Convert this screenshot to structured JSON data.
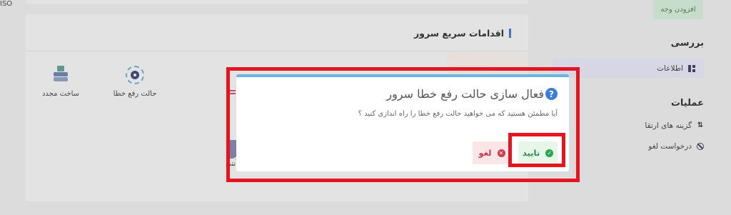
{
  "sidebar": {
    "add_funds_label": "افزودن وجه",
    "review_heading": "بررسی",
    "info_label": "اطلاعات",
    "operations_heading": "عملیات",
    "upgrade_label": "گزینه های ارتقا",
    "cancel_request_label": "درخواست لغو"
  },
  "quick_actions": {
    "title": "اقدامات سریع سرور",
    "actions": [
      {
        "label": "ساخت مجدد",
        "icon": "server-rebuild-icon"
      },
      {
        "label": "حالت رفع خطا",
        "icon": "rescue-gear-icon"
      },
      {
        "label": "ISO",
        "icon": "iso-icon"
      },
      {
        "label": "آنتی",
        "icon": "shield-icon"
      }
    ]
  },
  "modal": {
    "title": "فعال سازی حالت رفع خطا سرور",
    "message": "آیا مطمئن هستید که می خواهید حالت رفع خطا را راه اندازی کنید ؟",
    "confirm_label": "تایید",
    "cancel_label": "لغو",
    "icon": "question-icon"
  },
  "colors": {
    "highlight": "#e5141e",
    "accent": "#3b7dd8",
    "confirm": "#2aa54c",
    "cancel": "#d23b4c"
  }
}
